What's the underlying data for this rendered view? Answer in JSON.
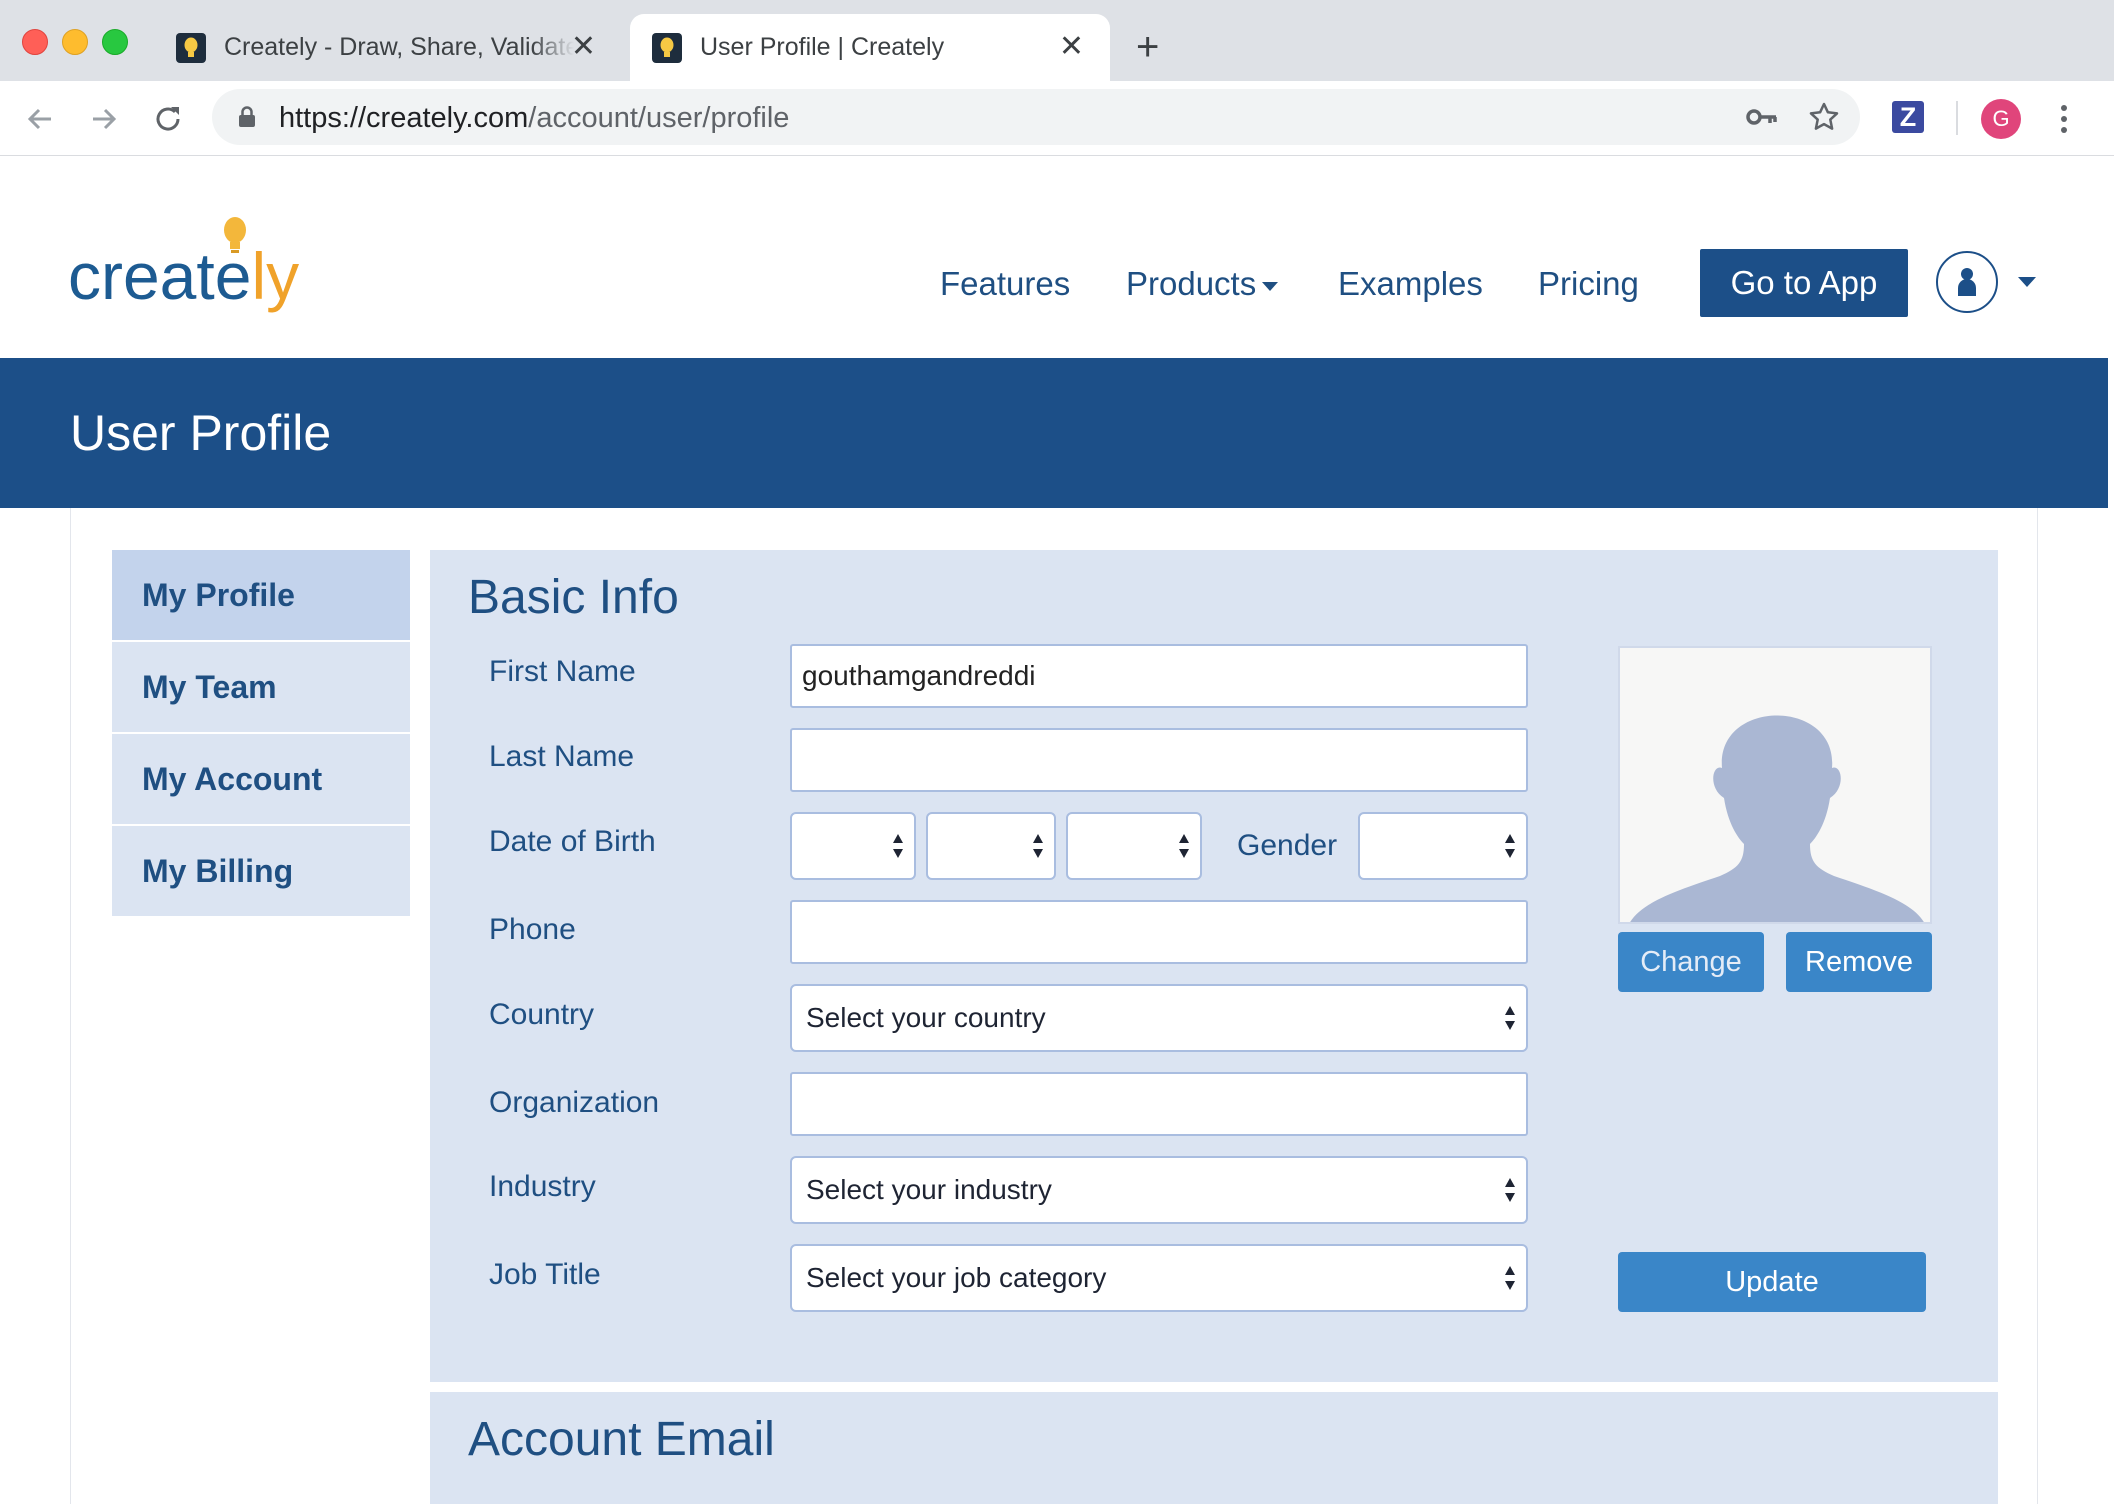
{
  "browser": {
    "tabs": [
      {
        "title": "Creately - Draw, Share, Validate",
        "active": false
      },
      {
        "title": "User Profile | Creately",
        "active": true
      }
    ],
    "url_host": "https://creately.com",
    "url_path": "/account/user/profile",
    "profile_initial": "G",
    "extension_label": "Z",
    "icons": [
      "back-icon",
      "forward-icon",
      "reload-icon",
      "lock-icon",
      "key-icon",
      "star-icon",
      "menu-icon"
    ]
  },
  "site": {
    "logo_text_main": "create",
    "logo_text_accent": "ly",
    "nav": {
      "features": "Features",
      "products": "Products",
      "examples": "Examples",
      "pricing": "Pricing",
      "go_to_app": "Go to App"
    },
    "brand_color": "#1c4f88",
    "accent_color": "#f0a22a"
  },
  "banner": {
    "title": "User Profile"
  },
  "sidebar": {
    "items": [
      {
        "label": "My Profile",
        "active": true
      },
      {
        "label": "My Team",
        "active": false
      },
      {
        "label": "My Account",
        "active": false
      },
      {
        "label": "My Billing",
        "active": false
      }
    ]
  },
  "basic_info": {
    "heading": "Basic Info",
    "first_name_label": "First Name",
    "first_name_value": "gouthamgandreddi",
    "last_name_label": "Last Name",
    "last_name_value": "",
    "dob_label": "Date of Birth",
    "dob_day": "",
    "dob_month": "",
    "dob_year": "",
    "gender_label": "Gender",
    "gender_value": "",
    "phone_label": "Phone",
    "phone_value": "",
    "country_label": "Country",
    "country_value": "Select your country",
    "organization_label": "Organization",
    "organization_value": "",
    "industry_label": "Industry",
    "industry_value": "Select your industry",
    "job_title_label": "Job Title",
    "job_title_value": "Select your job category",
    "change_label": "Change",
    "remove_label": "Remove",
    "update_label": "Update"
  },
  "account_email": {
    "heading": "Account Email"
  }
}
